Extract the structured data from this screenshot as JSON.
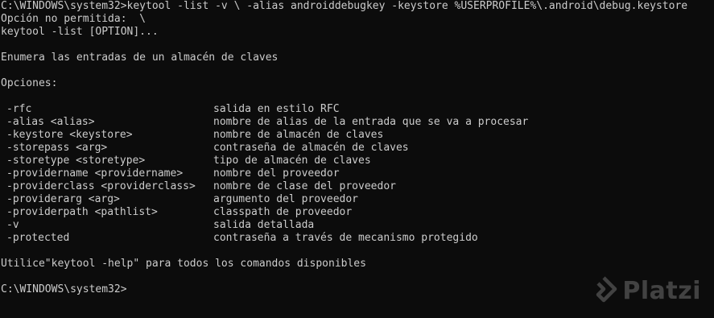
{
  "console": {
    "command_line": "C:\\WINDOWS\\system32>keytool -list -v \\ -alias androiddebugkey -keystore %USERPROFILE%\\.android\\debug.keystore",
    "error_line": "Opción no permitida:  \\",
    "usage_line": "keytool -list [OPTION]...",
    "description": "Enumera las entradas de un almacén de claves",
    "options_header": "Opciones:",
    "options": [
      {
        "name": "-rfc",
        "desc": "salida en estilo RFC"
      },
      {
        "name": "-alias <alias>",
        "desc": "nombre de alias de la entrada que se va a procesar"
      },
      {
        "name": "-keystore <keystore>",
        "desc": "nombre de almacén de claves"
      },
      {
        "name": "-storepass <arg>",
        "desc": "contraseña de almacén de claves"
      },
      {
        "name": "-storetype <storetype>",
        "desc": "tipo de almacén de claves"
      },
      {
        "name": "-providername <providername>",
        "desc": "nombre del proveedor"
      },
      {
        "name": "-providerclass <providerclass>",
        "desc": "nombre de clase del proveedor"
      },
      {
        "name": "-providerarg <arg>",
        "desc": "argumento del proveedor"
      },
      {
        "name": "-providerpath <pathlist>",
        "desc": "classpath de proveedor"
      },
      {
        "name": "-v",
        "desc": "salida detallada"
      },
      {
        "name": "-protected",
        "desc": "contraseña a través de mecanismo protegido"
      }
    ],
    "help_line": "Utilice\"keytool -help\" para todos los comandos disponibles",
    "prompt": "C:\\WINDOWS\\system32>"
  },
  "watermark": {
    "text": "Platzi",
    "icon": "platzi-logo-icon"
  },
  "colors": {
    "background": "#0c0c0c",
    "foreground": "#cccccc"
  }
}
